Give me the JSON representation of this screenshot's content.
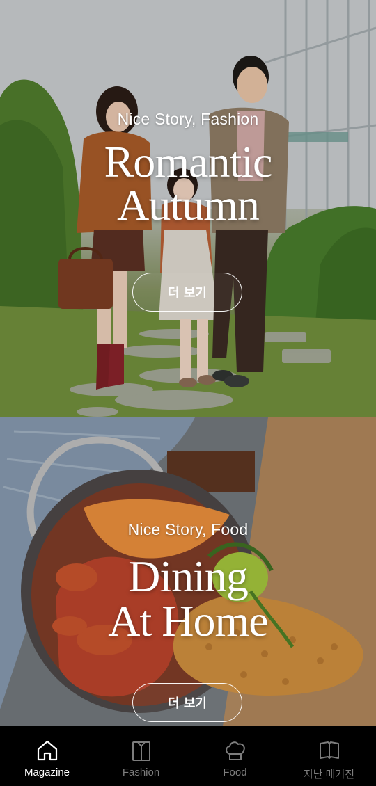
{
  "fashion": {
    "kicker": "Nice Story, Fashion",
    "title_line1": "Romantic",
    "title_line2": "Autumn",
    "button_label": "더 보기"
  },
  "food": {
    "kicker": "Nice Story, Food",
    "title_line1": "Dining",
    "title_line2": "At Home",
    "button_label": "더 보기"
  },
  "nav": {
    "items": [
      {
        "label": "Magazine",
        "icon": "home-icon",
        "active": true
      },
      {
        "label": "Fashion",
        "icon": "shirt-icon",
        "active": false
      },
      {
        "label": "Food",
        "icon": "chef-hat-icon",
        "active": false
      },
      {
        "label": "지난 매거진",
        "icon": "book-icon",
        "active": false
      }
    ]
  },
  "colors": {
    "nav_background": "#000000",
    "nav_active": "#ffffff",
    "nav_inactive": "#7d7d7d",
    "food_background": "#a98158"
  }
}
